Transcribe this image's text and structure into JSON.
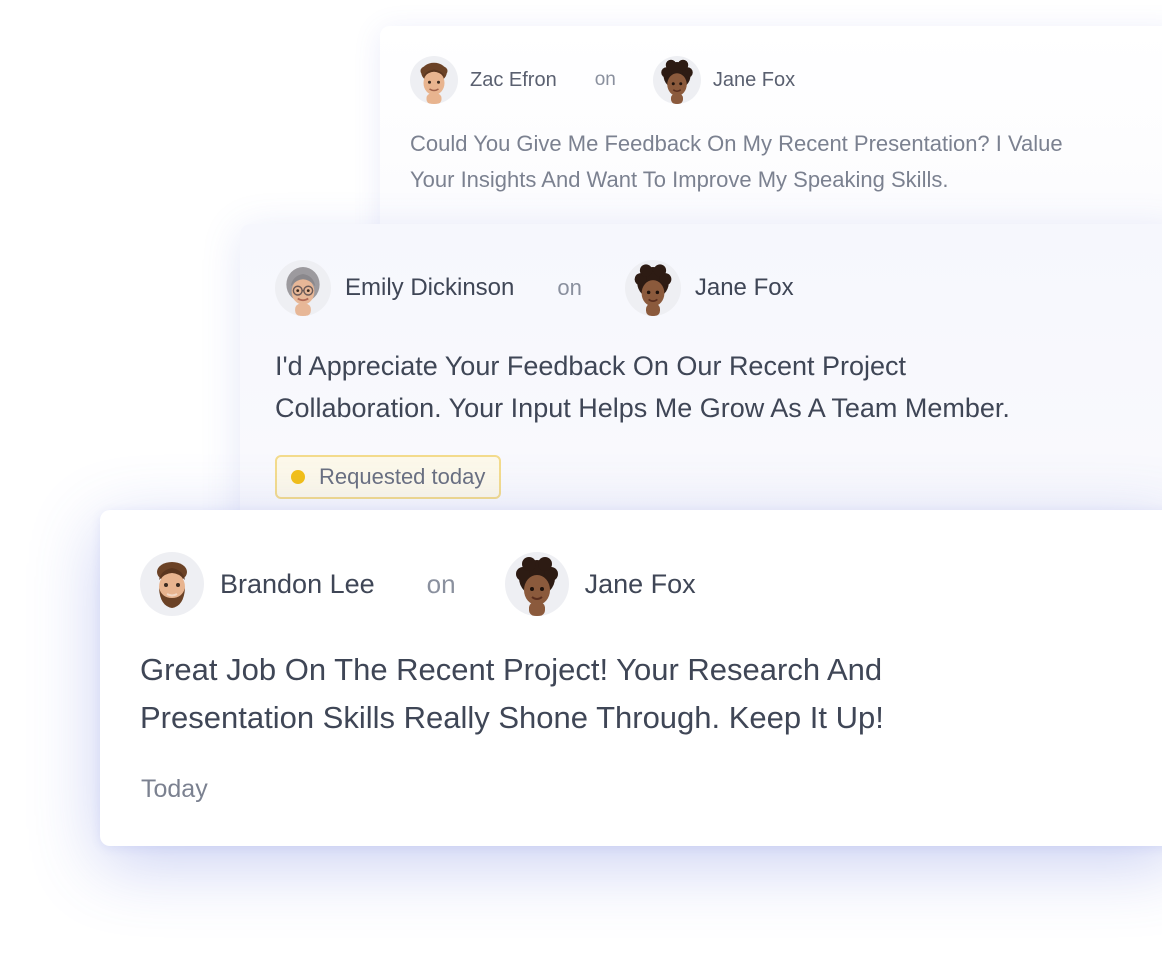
{
  "cards": [
    {
      "author": "Zac Efron",
      "connector": "on",
      "recipient": "Jane Fox",
      "message": "Could You Give Me Feedback On My Recent Presentation? I Value\nYour Insights And Want To Improve My Speaking Skills."
    },
    {
      "author": "Emily Dickinson",
      "connector": "on",
      "recipient": "Jane Fox",
      "message": "I'd Appreciate Your Feedback On Our Recent Project\nCollaboration. Your Input Helps Me Grow As A Team Member.",
      "status": "Requested today",
      "status_color": "#f3c017"
    },
    {
      "author": "Brandon Lee",
      "connector": "on",
      "recipient": "Jane Fox",
      "message": "Great Job On The Recent Project! Your Research And\nPresentation Skills Really Shone Through. Keep It Up!",
      "timestamp": "Today"
    }
  ],
  "icons": {
    "author_1": "curly-haired-man-avatar-icon",
    "author_2": "grey-haired-woman-with-glasses-avatar-icon",
    "author_3": "bearded-man-avatar-icon",
    "recipient": "curly-haired-woman-avatar-icon"
  }
}
